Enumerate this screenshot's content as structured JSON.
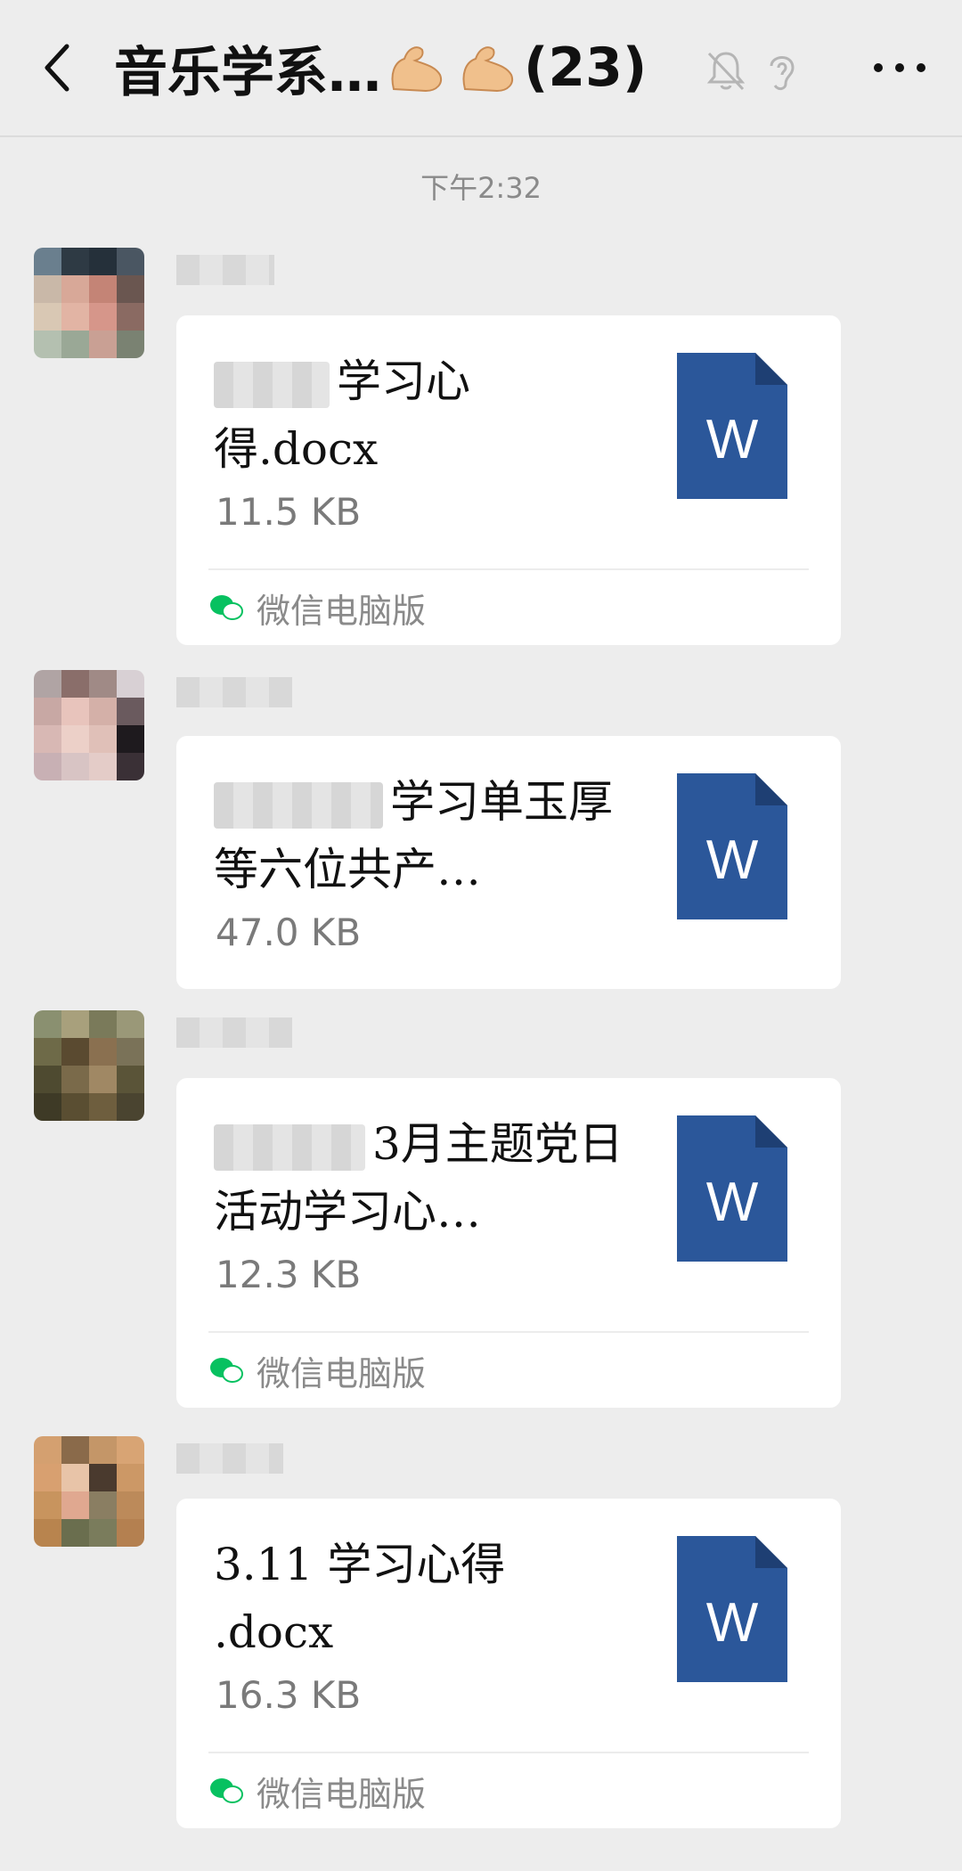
{
  "header": {
    "title": "音乐学系…",
    "count": "(23)"
  },
  "timestamp": "下午2:32",
  "messages": [
    {
      "file_name": "学习心得.docx",
      "file_size": "11.5 KB",
      "source": "微信电脑版"
    },
    {
      "file_name": "学习单玉厚等六位共产…",
      "file_size": "47.0 KB"
    },
    {
      "file_name": "3月主题党日活动学习心…",
      "file_size": "12.3 KB",
      "source": "微信电脑版"
    },
    {
      "file_name": "3.11 学习心得 .docx",
      "file_size": "16.3 KB",
      "source": "微信电脑版"
    }
  ],
  "icons": {
    "back": "chevron-left-icon",
    "mute": "bell-muted-icon",
    "ear": "ear-icon",
    "more": "more-icon",
    "file": "word-doc-icon",
    "source": "wechat-icon"
  },
  "colors": {
    "word_blue": "#2b579a",
    "wechat_green": "#07c160"
  }
}
